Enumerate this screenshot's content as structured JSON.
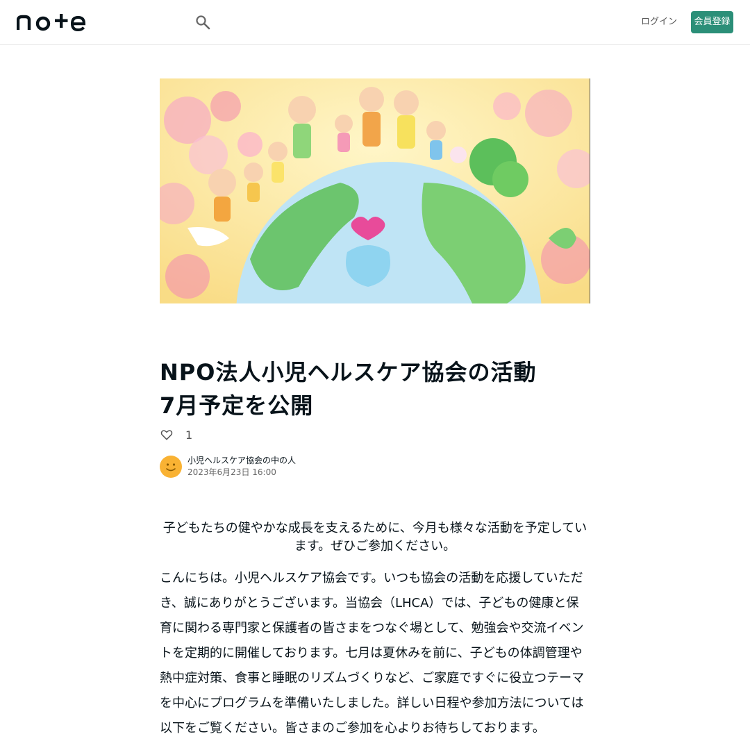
{
  "header": {
    "logo_text": "note",
    "login_label": "ログイン",
    "signup_label": "会員登録"
  },
  "article": {
    "title": "NPO法人小児ヘルスケア協会の活動\n7月予定を公開",
    "likes": "1",
    "author": {
      "name": "小児ヘルスケア協会の中の人",
      "date": "2023年6月23日 16:00"
    },
    "lead": "子どもたちの健やかな成長を支えるために、今月も様々な活動を予定しています。ぜひご参加ください。",
    "body": "こんにちは。小児ヘルスケア協会です。いつも協会の活動を応援していただき、誠にありがとうございます。当協会（LHCA）では、子どもの健康と保育に関わる専門家と保護者の皆さまをつなぐ場として、勉強会や交流イベントを定期的に開催しております。七月は夏休みを前に、子どもの体調管理や熱中症対策、食事と睡眠のリズムづくりなど、ご家庭ですぐに役立つテーマを中心にプログラムを準備いたしました。詳しい日程や参加方法については以下をご覧ください。皆さまのご参加を心よりお待ちしております。"
  },
  "colors": {
    "accent": "#2b8f78",
    "text": "#08131a",
    "avatar": "#f9b233"
  },
  "icons": {
    "search": "search-icon",
    "like": "heart-icon",
    "avatar": "smiley-icon"
  }
}
